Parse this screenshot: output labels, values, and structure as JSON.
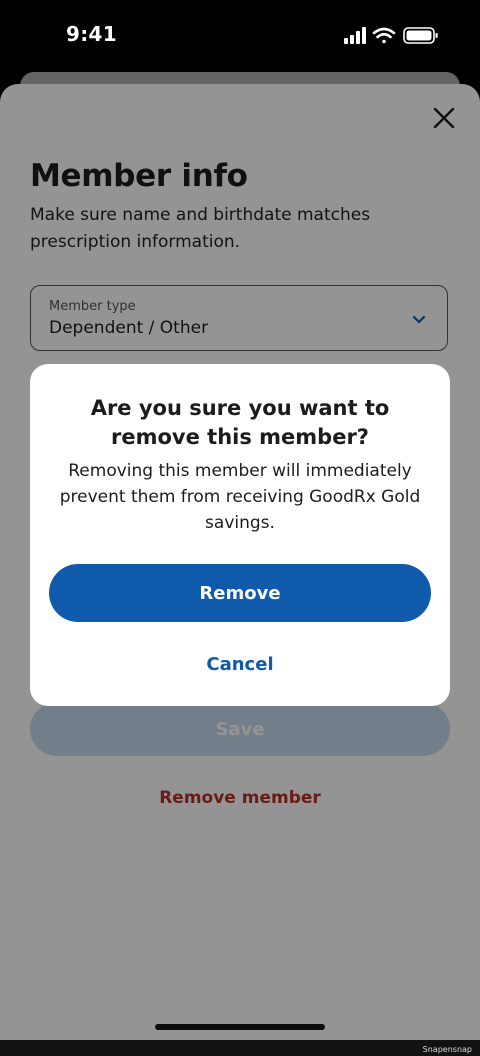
{
  "status_bar": {
    "time": "9:41"
  },
  "sheet": {
    "title": "Member info",
    "subtitle": "Make sure name and birthdate matches prescription information.",
    "member_type": {
      "label": "Member type",
      "value": "Dependent / Other"
    },
    "save_label": "Save",
    "remove_member_label": "Remove member"
  },
  "dialog": {
    "title": "Are you sure you want to remove this member?",
    "body": "Removing this member will immediately prevent them from receiving GoodRx Gold savings.",
    "confirm_label": "Remove",
    "cancel_label": "Cancel"
  },
  "watermark": "Snapensnap",
  "colors": {
    "primary": "#0f5aab",
    "destructive": "#b83025",
    "scrim": "rgba(0,0,0,0.42)"
  },
  "icons": {
    "close": "close-icon",
    "chevron": "chevron-down-icon",
    "signal": "signal-icon",
    "wifi": "wifi-icon",
    "battery": "battery-icon"
  }
}
